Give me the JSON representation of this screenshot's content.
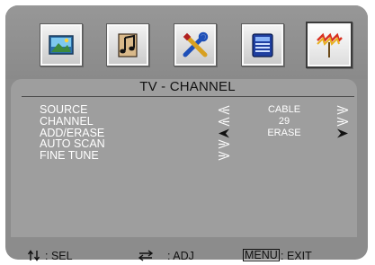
{
  "tabs": [
    {
      "name": "picture-tab",
      "icon": "picture-icon",
      "active": false
    },
    {
      "name": "audio-tab",
      "icon": "music-note-icon",
      "active": false
    },
    {
      "name": "setup-tab",
      "icon": "tools-icon",
      "active": false
    },
    {
      "name": "feature-tab",
      "icon": "keypad-icon",
      "active": false
    },
    {
      "name": "tv-tab",
      "icon": "antenna-icon",
      "active": true
    }
  ],
  "panel_title": "TV - CHANNEL",
  "rows": [
    {
      "label": "SOURCE",
      "value": "CABLE",
      "left_arrow": true,
      "right_arrow": true,
      "filled": false
    },
    {
      "label": "CHANNEL",
      "value": "29",
      "left_arrow": true,
      "right_arrow": true,
      "filled": false
    },
    {
      "label": "ADD/ERASE",
      "value": "ERASE",
      "left_arrow": true,
      "right_arrow": true,
      "filled": true
    },
    {
      "label": "AUTO SCAN",
      "value": "",
      "left_arrow": false,
      "right_arrow": true,
      "filled": false
    },
    {
      "label": "FINE TUNE",
      "value": "",
      "left_arrow": false,
      "right_arrow": true,
      "filled": false
    }
  ],
  "footer": {
    "sel": ": SEL",
    "adj": ": ADJ",
    "menu": "MENU",
    "exit": ": EXIT"
  },
  "colors": {
    "frame": "#8c8c8c",
    "panel": "#9e9e9e",
    "text": "#ffffff"
  }
}
